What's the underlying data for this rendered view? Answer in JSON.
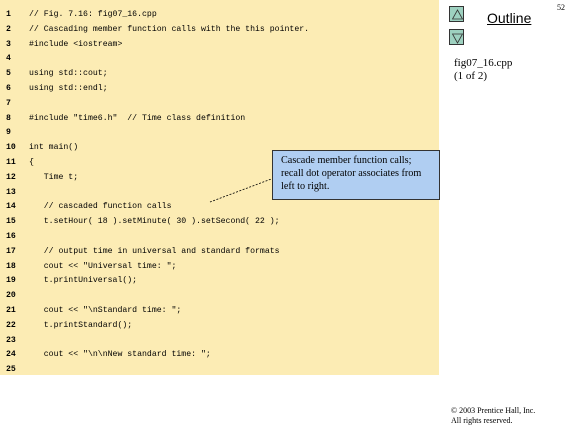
{
  "slide_number": "52",
  "outline_title": "Outline",
  "file_name": "fig07_16.cpp",
  "page_info": "(1 of 2)",
  "callout": "Cascade member function calls; recall dot operator associates from left to right.",
  "copyright_line1": "© 2003 Prentice Hall, Inc.",
  "copyright_line2": "All rights reserved.",
  "code": [
    {
      "n": "1",
      "text": "// Fig. 7.16: fig07_16.cpp"
    },
    {
      "n": "2",
      "text": "// Cascading member function calls with the this pointer."
    },
    {
      "n": "3",
      "text": "#include <iostream>"
    },
    {
      "n": "4",
      "text": ""
    },
    {
      "n": "5",
      "text": "using std::cout;"
    },
    {
      "n": "6",
      "text": "using std::endl;"
    },
    {
      "n": "7",
      "text": ""
    },
    {
      "n": "8",
      "text": "#include \"time6.h\"  // Time class definition"
    },
    {
      "n": "9",
      "text": ""
    },
    {
      "n": "10",
      "text": "int main()"
    },
    {
      "n": "11",
      "text": "{"
    },
    {
      "n": "12",
      "text": "   Time t;"
    },
    {
      "n": "13",
      "text": ""
    },
    {
      "n": "14",
      "text": "   // cascaded function calls"
    },
    {
      "n": "15",
      "text": "   t.setHour( 18 ).setMinute( 30 ).setSecond( 22 );"
    },
    {
      "n": "16",
      "text": ""
    },
    {
      "n": "17",
      "text": "   // output time in universal and standard formats"
    },
    {
      "n": "18",
      "text": "   cout << \"Universal time: \";"
    },
    {
      "n": "19",
      "text": "   t.printUniversal();"
    },
    {
      "n": "20",
      "text": ""
    },
    {
      "n": "21",
      "text": "   cout << \"\\nStandard time: \";"
    },
    {
      "n": "22",
      "text": "   t.printStandard();"
    },
    {
      "n": "23",
      "text": ""
    },
    {
      "n": "24",
      "text": "   cout << \"\\n\\nNew standard time: \";"
    },
    {
      "n": "25",
      "text": ""
    }
  ],
  "colors": {
    "code_background": "#fcecb4",
    "callout_background": "#b0cef2",
    "nav_button": "#9ed1c0"
  }
}
